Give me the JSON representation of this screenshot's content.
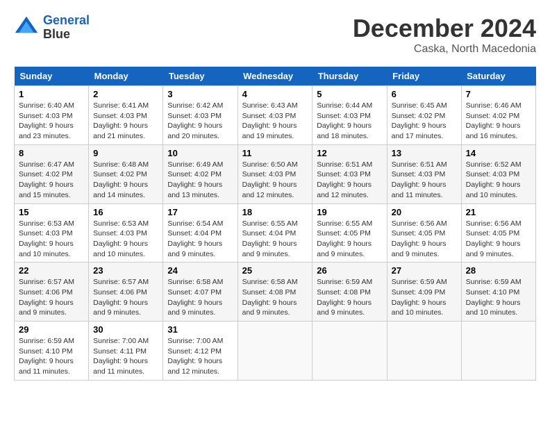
{
  "logo": {
    "line1": "General",
    "line2": "Blue"
  },
  "title": "December 2024",
  "location": "Caska, North Macedonia",
  "weekdays": [
    "Sunday",
    "Monday",
    "Tuesday",
    "Wednesday",
    "Thursday",
    "Friday",
    "Saturday"
  ],
  "weeks": [
    [
      {
        "day": "1",
        "sunrise": "6:40 AM",
        "sunset": "4:03 PM",
        "daylight": "9 hours and 23 minutes."
      },
      {
        "day": "2",
        "sunrise": "6:41 AM",
        "sunset": "4:03 PM",
        "daylight": "9 hours and 21 minutes."
      },
      {
        "day": "3",
        "sunrise": "6:42 AM",
        "sunset": "4:03 PM",
        "daylight": "9 hours and 20 minutes."
      },
      {
        "day": "4",
        "sunrise": "6:43 AM",
        "sunset": "4:03 PM",
        "daylight": "9 hours and 19 minutes."
      },
      {
        "day": "5",
        "sunrise": "6:44 AM",
        "sunset": "4:03 PM",
        "daylight": "9 hours and 18 minutes."
      },
      {
        "day": "6",
        "sunrise": "6:45 AM",
        "sunset": "4:02 PM",
        "daylight": "9 hours and 17 minutes."
      },
      {
        "day": "7",
        "sunrise": "6:46 AM",
        "sunset": "4:02 PM",
        "daylight": "9 hours and 16 minutes."
      }
    ],
    [
      {
        "day": "8",
        "sunrise": "6:47 AM",
        "sunset": "4:02 PM",
        "daylight": "9 hours and 15 minutes."
      },
      {
        "day": "9",
        "sunrise": "6:48 AM",
        "sunset": "4:02 PM",
        "daylight": "9 hours and 14 minutes."
      },
      {
        "day": "10",
        "sunrise": "6:49 AM",
        "sunset": "4:02 PM",
        "daylight": "9 hours and 13 minutes."
      },
      {
        "day": "11",
        "sunrise": "6:50 AM",
        "sunset": "4:03 PM",
        "daylight": "9 hours and 12 minutes."
      },
      {
        "day": "12",
        "sunrise": "6:51 AM",
        "sunset": "4:03 PM",
        "daylight": "9 hours and 12 minutes."
      },
      {
        "day": "13",
        "sunrise": "6:51 AM",
        "sunset": "4:03 PM",
        "daylight": "9 hours and 11 minutes."
      },
      {
        "day": "14",
        "sunrise": "6:52 AM",
        "sunset": "4:03 PM",
        "daylight": "9 hours and 10 minutes."
      }
    ],
    [
      {
        "day": "15",
        "sunrise": "6:53 AM",
        "sunset": "4:03 PM",
        "daylight": "9 hours and 10 minutes."
      },
      {
        "day": "16",
        "sunrise": "6:53 AM",
        "sunset": "4:03 PM",
        "daylight": "9 hours and 10 minutes."
      },
      {
        "day": "17",
        "sunrise": "6:54 AM",
        "sunset": "4:04 PM",
        "daylight": "9 hours and 9 minutes."
      },
      {
        "day": "18",
        "sunrise": "6:55 AM",
        "sunset": "4:04 PM",
        "daylight": "9 hours and 9 minutes."
      },
      {
        "day": "19",
        "sunrise": "6:55 AM",
        "sunset": "4:05 PM",
        "daylight": "9 hours and 9 minutes."
      },
      {
        "day": "20",
        "sunrise": "6:56 AM",
        "sunset": "4:05 PM",
        "daylight": "9 hours and 9 minutes."
      },
      {
        "day": "21",
        "sunrise": "6:56 AM",
        "sunset": "4:05 PM",
        "daylight": "9 hours and 9 minutes."
      }
    ],
    [
      {
        "day": "22",
        "sunrise": "6:57 AM",
        "sunset": "4:06 PM",
        "daylight": "9 hours and 9 minutes."
      },
      {
        "day": "23",
        "sunrise": "6:57 AM",
        "sunset": "4:06 PM",
        "daylight": "9 hours and 9 minutes."
      },
      {
        "day": "24",
        "sunrise": "6:58 AM",
        "sunset": "4:07 PM",
        "daylight": "9 hours and 9 minutes."
      },
      {
        "day": "25",
        "sunrise": "6:58 AM",
        "sunset": "4:08 PM",
        "daylight": "9 hours and 9 minutes."
      },
      {
        "day": "26",
        "sunrise": "6:59 AM",
        "sunset": "4:08 PM",
        "daylight": "9 hours and 9 minutes."
      },
      {
        "day": "27",
        "sunrise": "6:59 AM",
        "sunset": "4:09 PM",
        "daylight": "9 hours and 10 minutes."
      },
      {
        "day": "28",
        "sunrise": "6:59 AM",
        "sunset": "4:10 PM",
        "daylight": "9 hours and 10 minutes."
      }
    ],
    [
      {
        "day": "29",
        "sunrise": "6:59 AM",
        "sunset": "4:10 PM",
        "daylight": "9 hours and 11 minutes."
      },
      {
        "day": "30",
        "sunrise": "7:00 AM",
        "sunset": "4:11 PM",
        "daylight": "9 hours and 11 minutes."
      },
      {
        "day": "31",
        "sunrise": "7:00 AM",
        "sunset": "4:12 PM",
        "daylight": "9 hours and 12 minutes."
      },
      null,
      null,
      null,
      null
    ]
  ],
  "labels": {
    "sunrise": "Sunrise:",
    "sunset": "Sunset:",
    "daylight": "Daylight:"
  }
}
